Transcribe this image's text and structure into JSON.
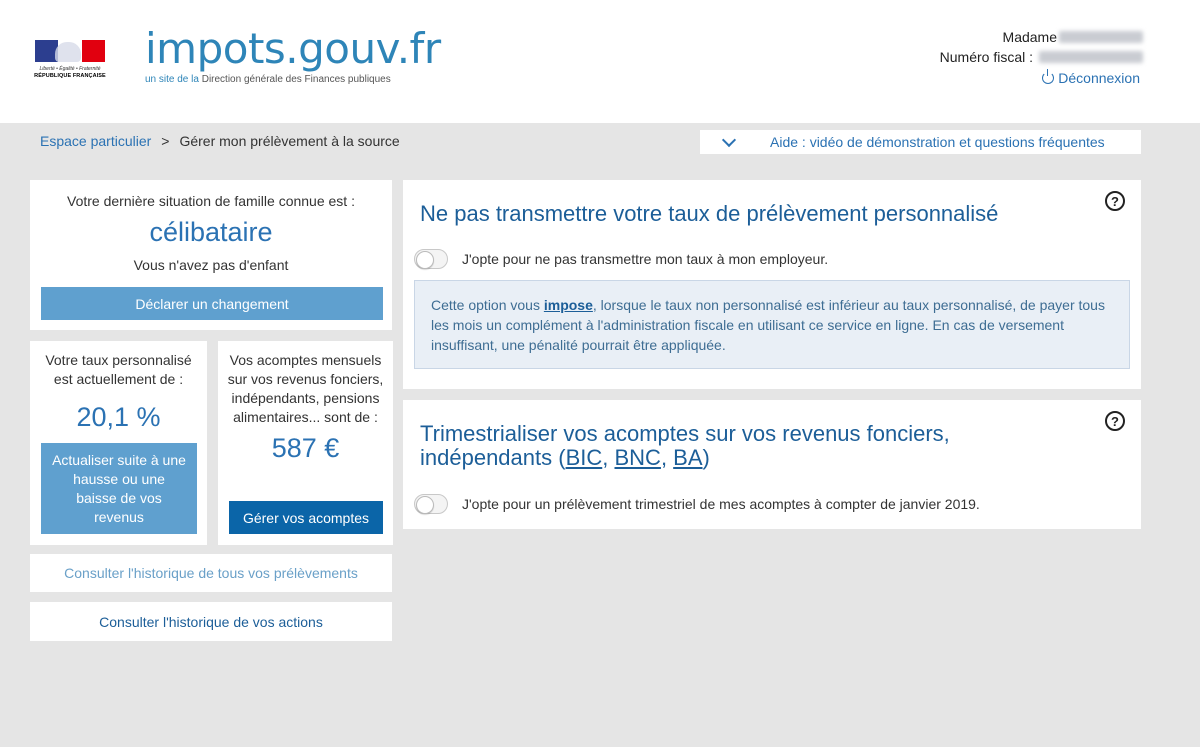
{
  "header": {
    "logo": {
      "motto": "Liberté • Égalité • Fraternité",
      "name": "RÉPUBLIQUE FRANÇAISE"
    },
    "brand": {
      "name": "impots.gouv.fr",
      "sub_prefix": "un site de la ",
      "sub_main": "Direction générale des Finances publiques"
    },
    "user": {
      "title_label": "Madame",
      "fiscal_label": "Numéro fiscal :",
      "logout_label": "Déconnexion"
    }
  },
  "breadcrumb": {
    "home": "Espace particulier",
    "separator": ">",
    "current": "Gérer mon prélèvement à la source"
  },
  "help_bar": {
    "label": "Aide : vidéo de démonstration et questions fréquentes"
  },
  "family_card": {
    "label": "Votre dernière situation de famille connue est :",
    "status": "célibataire",
    "children": "Vous n'avez pas d'enfant",
    "button": "Déclarer un changement"
  },
  "rate_card": {
    "label": "Votre taux personnalisé est actuellement de :",
    "value": "20,1 %",
    "button": "Actualiser suite à une hausse ou une baisse de vos revenus"
  },
  "acompte_card": {
    "label": "Vos acomptes mensuels sur vos revenus fonciers, indépendants, pensions alimentaires... sont de :",
    "value": "587 €",
    "button": "Gérer vos acomptes"
  },
  "history": {
    "all_withdrawals": "Consulter l'historique de tous vos prélèvements",
    "actions": "Consulter l'historique de vos actions"
  },
  "section_no_transmit": {
    "title": "Ne pas transmettre votre taux de prélèvement personnalisé",
    "help": "?",
    "toggle_label": "J'opte pour ne pas transmettre mon taux à mon employeur.",
    "info_before": "Cette option vous ",
    "info_bold": "impose",
    "info_after": ", lorsque le taux non personnalisé est inférieur au taux personnalisé, de payer tous les mois un complément à l'administration fiscale en utilisant ce service en ligne. En cas de versement insuffisant, une pénalité pourrait être appliquée."
  },
  "section_quarterly": {
    "title_line1": "Trimestrialiser vos acomptes sur vos revenus fonciers,",
    "title_line2_prefix": "indépendants (",
    "link_bic": "BIC",
    "sep1": ", ",
    "link_bnc": "BNC",
    "sep2": ", ",
    "link_ba": "BA",
    "title_line2_suffix": ")",
    "help": "?",
    "toggle_label": "J'opte pour un prélèvement trimestriel de mes acomptes à compter de janvier 2019."
  }
}
